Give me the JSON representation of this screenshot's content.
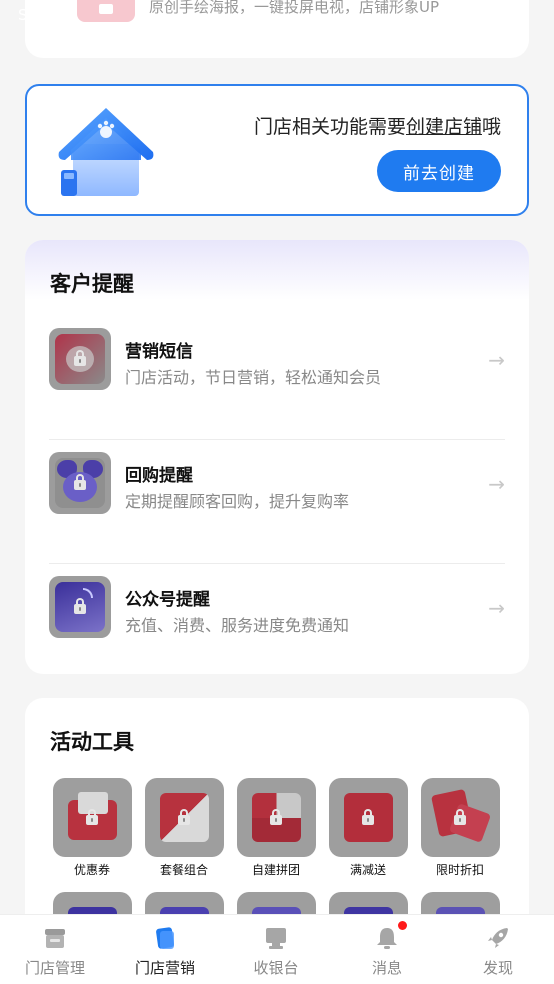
{
  "top_card": {
    "status_letter": "S",
    "text": "原创手绘海报，一键投屏电视，店铺形象UP"
  },
  "store_banner": {
    "message_prefix": "门店相关功能需要",
    "message_link": "创建店铺",
    "message_suffix": "哦",
    "button_label": "前去创建",
    "accent_color": "#1f7bf0"
  },
  "reminders": {
    "title": "客户提醒",
    "items": [
      {
        "label": "营销短信",
        "desc": "门店活动，节日营销，轻松通知会员",
        "icon": "sms-icon"
      },
      {
        "label": "回购提醒",
        "desc": "定期提醒顾客回购，提升复购率",
        "icon": "gift-bow-icon"
      },
      {
        "label": "公众号提醒",
        "desc": "充值、消费、服务进度免费通知",
        "icon": "wechat-notify-icon"
      }
    ],
    "arrow": "→"
  },
  "tools": {
    "title": "活动工具",
    "items": [
      {
        "label": "优惠券",
        "icon": "coupon-icon"
      },
      {
        "label": "套餐组合",
        "icon": "package-combo-icon"
      },
      {
        "label": "自建拼团",
        "icon": "group-buy-icon"
      },
      {
        "label": "满减送",
        "icon": "discount-icon"
      },
      {
        "label": "限时折扣",
        "icon": "time-discount-icon"
      }
    ]
  },
  "bottom_nav": {
    "items": [
      {
        "label": "门店管理",
        "icon": "store-icon",
        "active": false
      },
      {
        "label": "门店营销",
        "icon": "marketing-icon",
        "active": true
      },
      {
        "label": "收银台",
        "icon": "cashier-icon",
        "active": false
      },
      {
        "label": "消息",
        "icon": "bell-icon",
        "active": false,
        "badge": true
      },
      {
        "label": "发现",
        "icon": "rocket-icon",
        "active": false
      }
    ]
  }
}
